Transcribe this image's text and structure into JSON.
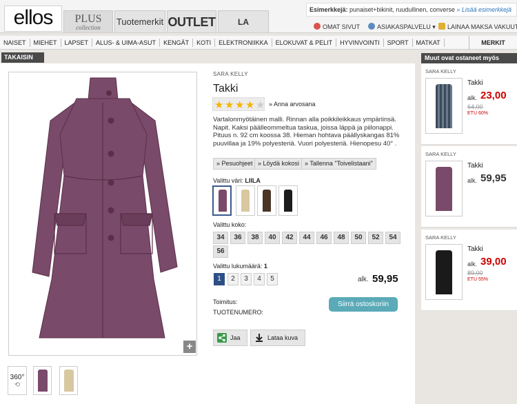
{
  "header": {
    "logo": "ellos",
    "tabs": {
      "plus_big": "PLUS",
      "plus_small": "collection",
      "tuotemerkit": "Tuotemerkit",
      "outlet": "OUTLET",
      "redoute": "LA REDOUTE"
    },
    "search_hint_label": "Esimerkkejä:",
    "search_hint_text": " punaiset+bikinit, ruudullinen, converse",
    "search_hint_more": "» Lisää esimerkkejä",
    "links": {
      "omat_sivut": "OMAT SIVUT",
      "asiakaspalvelu": "ASIAKASPALVELU",
      "lainaa": "LAINAA MAKSA VAKUUTA"
    }
  },
  "nav": {
    "items": [
      "NAISET",
      "MIEHET",
      "LAPSET",
      "ALUS- & UIMA-ASUT",
      "KENGÄT",
      "KOTI",
      "ELEKTRONIIKKA",
      "ELOKUVAT & PELIT",
      "HYVINVOINTI",
      "SPORT",
      "MATKAT"
    ],
    "merkit": "MERKIT"
  },
  "back_label": "TAKAISIN",
  "product": {
    "brand": "SARA KELLY",
    "title": "Takki",
    "rating_stars": 4,
    "rating_max": 5,
    "rate_link": "» Anna arvosana",
    "description": "Vartalonmyötäinen malli. Rinnan alla poikkileikkaus ympäriinsä. Napit. Kaksi päälleommeltua taskua, joissa läppä ja piilonappi. Pituus n. 92 cm koossa 38. Hieman hohtava päällyskangas 81% puuvillaa ja 19% polyesteriä. Vuori polyesteriä. Hienopesu 40° .",
    "buttons": {
      "care": "» Pesuohjeet",
      "size": "» Löydä kokosi",
      "wishlist": "» Tallenna \"Toivelistaani\""
    },
    "color_label": "Valittu väri:",
    "color_value": "LIILA",
    "colors": [
      "#7a4a6a",
      "#d8c8a0",
      "#4a3424",
      "#1c1c1c"
    ],
    "size_label": "Valittu koko:",
    "sizes": [
      "34",
      "36",
      "38",
      "40",
      "42",
      "44",
      "46",
      "48",
      "50",
      "52",
      "54",
      "56"
    ],
    "qty_label": "Valittu lukumäärä:",
    "qty_value": "1",
    "qty_options": [
      "1",
      "2",
      "3",
      "4",
      "5"
    ],
    "price_prefix": "alk.",
    "price": "59,95",
    "cart_button": "Siirrä ostoskoriin",
    "delivery_label": "Toimitus:",
    "product_number_label": "TUOTENUMERO:",
    "share_label": "Jaa",
    "download_label": "Lataa kuva",
    "thumb_360": "360°"
  },
  "right_column": {
    "heading": "Muut ovat ostaneet myös",
    "items": [
      {
        "brand": "SARA KELLY",
        "name": "Takki",
        "prefix": "alk.",
        "price": "23,00",
        "old_price": "64,00",
        "discount": "ETU 60%",
        "sale": true
      },
      {
        "brand": "SARA KELLY",
        "name": "Takki",
        "prefix": "alk.",
        "price": "59,95",
        "old_price": "",
        "discount": "",
        "sale": false
      },
      {
        "brand": "SARA KELLY",
        "name": "Takki",
        "prefix": "alk.",
        "price": "39,00",
        "old_price": "89,00",
        "discount": "ETU 55%",
        "sale": true
      }
    ]
  },
  "colors": {
    "accent_blue": "#2d4f86",
    "cart_button": "#5aaab8",
    "sale_red": "#cc0000",
    "coat_main": "#7a4a6a"
  }
}
